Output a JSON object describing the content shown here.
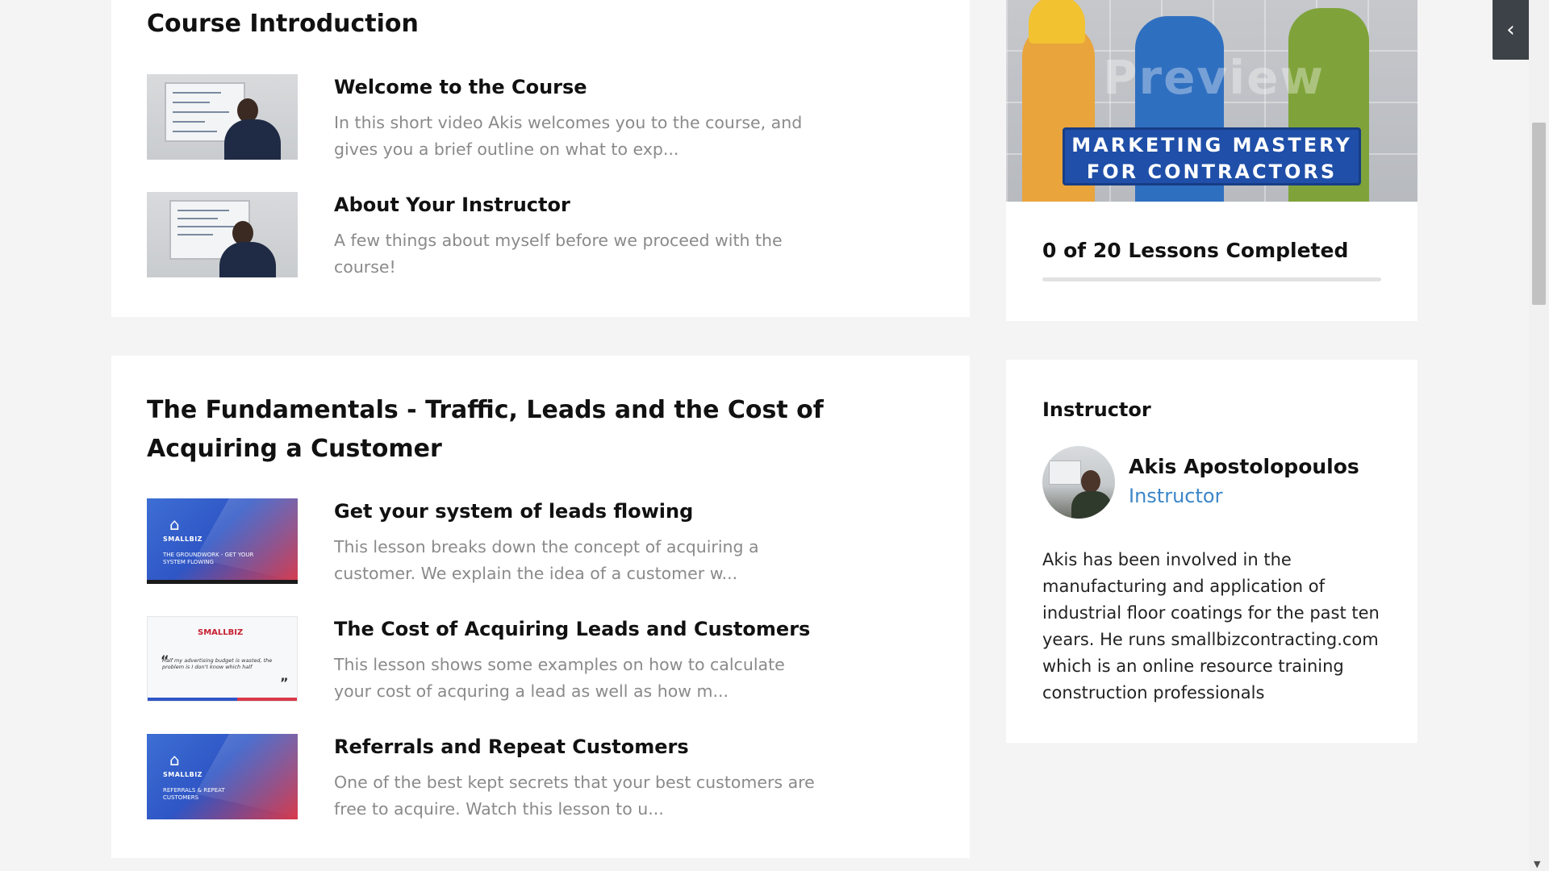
{
  "sections": [
    {
      "title": "Course Introduction",
      "lessons": [
        {
          "title": "Welcome to the Course",
          "description": "In this short video Akis welcomes you to the course, and gives you a brief outline on what to exp...",
          "thumbnail": "whiteboard-video"
        },
        {
          "title": "About Your Instructor",
          "description": "A few things about myself before we proceed with the course!",
          "thumbnail": "whiteboard-video"
        }
      ]
    },
    {
      "title": "The Fundamentals - Traffic, Leads and the Cost of Acquiring a Customer",
      "lessons": [
        {
          "title": "Get your system of leads flowing",
          "description": "This lesson breaks down the concept of acquiring a customer. We explain the idea of a customer w...",
          "thumbnail": "blue-slide",
          "thumb_brand": "SMALLBIZ",
          "thumb_caption": "THE GROUNDWORK - GET YOUR SYSTEM FLOWING"
        },
        {
          "title": "The Cost of Acquiring Leads and Customers",
          "description": "This lesson shows some examples on how to calculate your cost of acquring a lead as well as how m...",
          "thumbnail": "white-slide",
          "thumb_brand": "SMALLBIZ",
          "thumb_quote": "Half my advertising budget is wasted, the problem is I don't know which half"
        },
        {
          "title": "Referrals and Repeat Customers",
          "description": "One of the best kept secrets that your best customers are free to acquire. Watch this lesson to u...",
          "thumbnail": "blue-slide",
          "thumb_brand": "SMALLBIZ",
          "thumb_caption": "REFERRALS & REPEAT CUSTOMERS"
        }
      ]
    }
  ],
  "sidebar": {
    "course_banner": {
      "line1": "MARKETING MASTERY",
      "line2": "FOR CONTRACTORS",
      "watermark": "Preview"
    },
    "progress": {
      "label": "0 of 20 Lessons Completed",
      "completed": 0,
      "total": 20
    },
    "instructor": {
      "heading": "Instructor",
      "name": "Akis Apostolopoulos",
      "role": "Instructor",
      "bio": "Akis has been involved in the manufacturing and application of industrial floor coatings for the past ten years. He runs smallbizcontracting.com which is an online resource training construction professionals"
    }
  },
  "controls": {
    "collapse_icon": "chevron-left-icon",
    "collapse_glyph": "‹"
  },
  "colors": {
    "accent": "#3c86c9",
    "banner": "#1f4fa8",
    "page_bg": "#f4f4f4"
  }
}
